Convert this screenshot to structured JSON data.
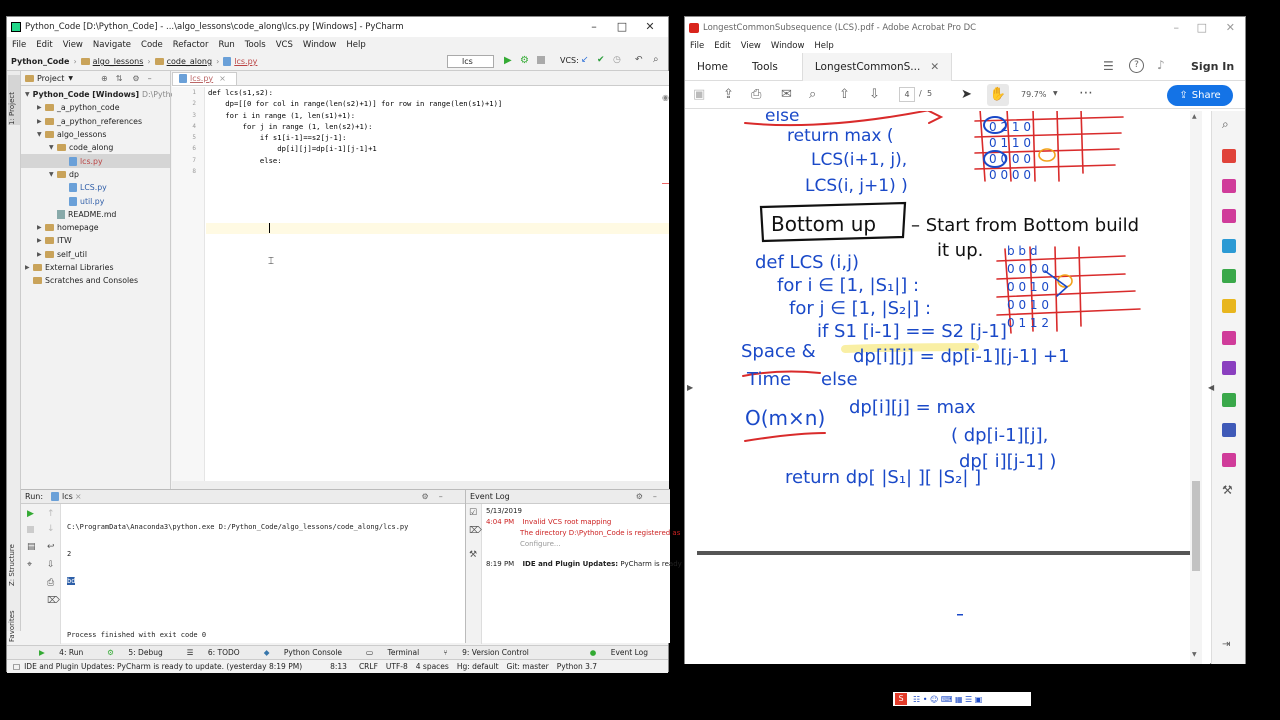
{
  "pycharm": {
    "title": "Python_Code [D:\\Python_Code] - ...\\algo_lessons\\code_along\\lcs.py [Windows] - PyCharm",
    "menu": [
      "File",
      "Edit",
      "View",
      "Navigate",
      "Code",
      "Refactor",
      "Run",
      "Tools",
      "VCS",
      "Window",
      "Help"
    ],
    "breadcrumbs": [
      "Python_Code",
      "algo_lessons",
      "code_along",
      "lcs.py"
    ],
    "run_config": "lcs",
    "vcs_label": "VCS:",
    "project_label": "Project",
    "editor_tab": "lcs.py",
    "tree": [
      {
        "label": "Python_Code [Windows]",
        "extra": "D:\\Python_Cod",
        "depth": 0,
        "type": "folder",
        "expanded": true
      },
      {
        "label": "_a_python_code",
        "depth": 1,
        "type": "folder"
      },
      {
        "label": "_a_python_references",
        "depth": 1,
        "type": "folder"
      },
      {
        "label": "algo_lessons",
        "depth": 1,
        "type": "folder",
        "expanded": true
      },
      {
        "label": "code_along",
        "depth": 2,
        "type": "folder",
        "expanded": true
      },
      {
        "label": "lcs.py",
        "depth": 3,
        "type": "py",
        "selected": true
      },
      {
        "label": "dp",
        "depth": 2,
        "type": "folder",
        "expanded": true
      },
      {
        "label": "LCS.py",
        "depth": 3,
        "type": "py"
      },
      {
        "label": "util.py",
        "depth": 3,
        "type": "py"
      },
      {
        "label": "README.md",
        "depth": 2,
        "type": "md"
      },
      {
        "label": "homepage",
        "depth": 1,
        "type": "folder"
      },
      {
        "label": "ITW",
        "depth": 1,
        "type": "folder"
      },
      {
        "label": "self_util",
        "depth": 1,
        "type": "folder"
      },
      {
        "label": "External Libraries",
        "depth": 0,
        "type": "lib"
      },
      {
        "label": "Scratches and Consoles",
        "depth": 0,
        "type": "scratch"
      }
    ],
    "line_numbers": [
      "1",
      "2",
      "3",
      "4",
      "5",
      "6",
      "7",
      "8"
    ],
    "code_lines": [
      "def lcs(s1,s2):",
      "    dp=[[0 for col in range(len(s2)+1)] for row in range(len(s1)+1)]",
      "    for i in range (1, len(s1)+1):",
      "        for j in range (1, len(s2)+1):",
      "            if s1[i-1]==s2[j-1]:",
      "                dp[i][j]=dp[i-1][j-1]+1",
      "            else:",
      "                "
    ],
    "run_label": "Run:",
    "run_tab": "lcs",
    "run_output": [
      "C:\\ProgramData\\Anaconda3\\python.exe D:/Python_Code/algo_lessons/code_along/lcs.py",
      "2",
      "bd",
      "",
      "Process finished with exit code 0"
    ],
    "event_log": {
      "title": "Event Log",
      "date": "5/13/2019",
      "entry1_time": "4:04 PM",
      "entry1_title": "Invalid VCS root mapping",
      "entry1_body": "The directory D:\\Python_Code is registered as",
      "entry1_link": "Configure...",
      "entry2_time": "8:19 PM",
      "entry2_title": "IDE and Plugin Updates:",
      "entry2_body": "PyCharm is ready to"
    },
    "bottom_tabs": [
      "4: Run",
      "5: Debug",
      "6: TODO",
      "Python Console",
      "Terminal",
      "9: Version Control"
    ],
    "event_log_tab": "Event Log",
    "status": {
      "message": "IDE and Plugin Updates: PyCharm is ready to update. (yesterday 8:19 PM)",
      "position": "8:13",
      "newline": "CRLF",
      "encoding": "UTF-8",
      "indent": "4 spaces",
      "hg": "Hg: default",
      "git": "Git: master",
      "interpreter": "Python 3.7"
    },
    "side_tabs": [
      "1: Project",
      "Z: Structure",
      "2: Favorites"
    ]
  },
  "acrobat": {
    "title": "LongestCommonSubsequence (LCS).pdf - Adobe Acrobat Pro DC",
    "menu": [
      "File",
      "Edit",
      "View",
      "Window",
      "Help"
    ],
    "tabs": [
      "Home",
      "Tools",
      "LongestCommonS..."
    ],
    "sign_in": "Sign In",
    "page_current": "4",
    "page_sep": "/",
    "page_total": "5",
    "zoom": "79.7%",
    "share": "Share"
  },
  "notes": {
    "else_return": "else\nreturn max (",
    "lcs_i1j": "LCS(i+1, j),",
    "lcs_ij1": "LCS(i, j+1) )",
    "bottom_up": "Bottom up",
    "start_from": "– Start from Bottom build",
    "it_up": "it up.",
    "def_lcs": "def LCS (i,j)",
    "for_i": "for i ∈ [1, |S₁|] :",
    "for_j": "for j ∈ [1, |S₂|] :",
    "if_line": "if S1 [i-1] == S2 [j-1]",
    "dp_eq": "dp[i][j] = dp[i-1][j-1] +1",
    "space": "Space &",
    "time": "Time",
    "else2": "else",
    "complexity": "O(m×n)",
    "dp_max": "dp[i][j] = max",
    "max_a": "( dp[i-1][j],",
    "max_b": "dp[ i][j-1] )",
    "return_line": "return dp[ |S₁| ][ |S₂| ]"
  },
  "colors": {
    "ink_blue": "#1a49c8",
    "ink_red": "#d92b2b",
    "ink_black": "#111111",
    "highlight_yellow": "#f2dc36",
    "accent": "#1473e6"
  }
}
